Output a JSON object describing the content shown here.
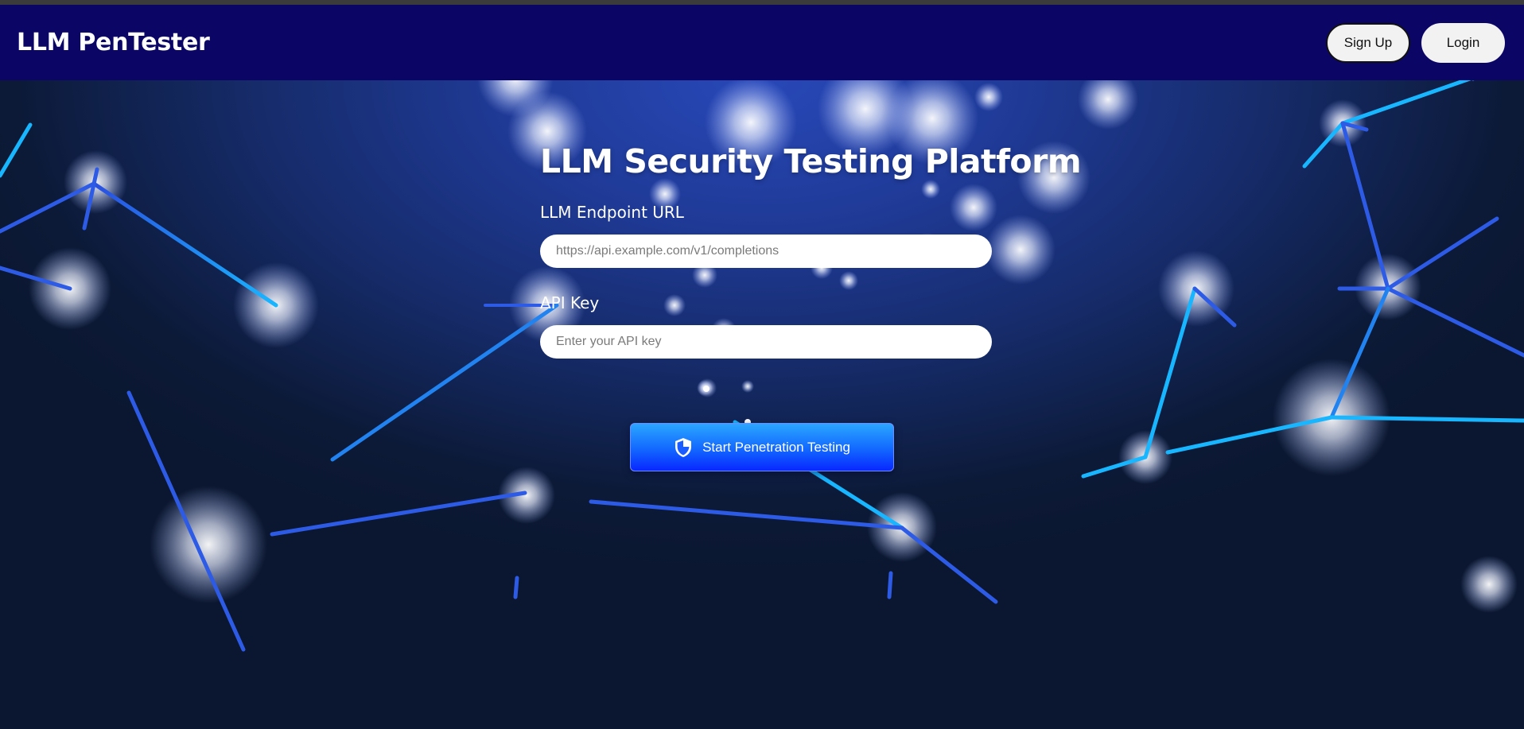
{
  "navbar": {
    "brand": "LLM PenTester",
    "signup_label": "Sign Up",
    "login_label": "Login"
  },
  "form": {
    "title": "LLM Security Testing Platform",
    "endpoint_label": "LLM Endpoint URL",
    "endpoint_placeholder": "https://api.example.com/v1/completions",
    "endpoint_value": "",
    "apikey_label": "API Key",
    "apikey_placeholder": "Enter your API key",
    "apikey_value": "",
    "submit_label": "Start Penetration Testing",
    "submit_icon": "shield-icon"
  },
  "colors": {
    "navbar_bg": "#0b0566",
    "accent_blue": "#1267ff",
    "line_cyan": "#18b6ff",
    "line_blue": "#2d5be6"
  }
}
